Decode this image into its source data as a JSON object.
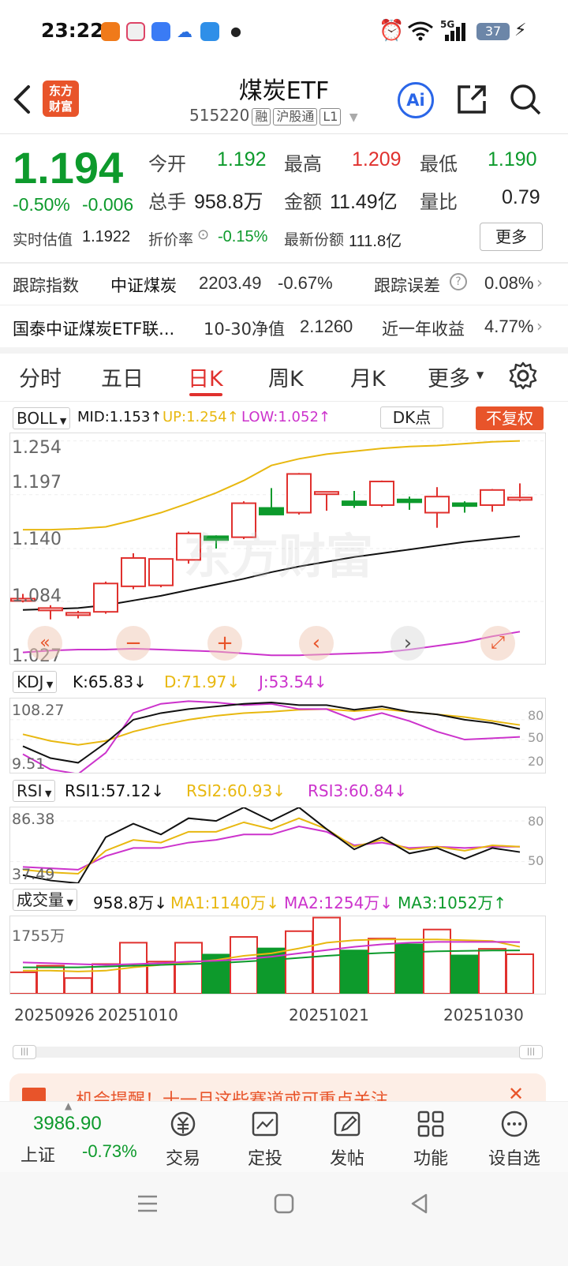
{
  "status": {
    "time": "23:22",
    "network": "5G",
    "battery": "37"
  },
  "header": {
    "title": "煤炭ETF",
    "code": "515220",
    "tags": [
      "融",
      "沪股通",
      "L1"
    ],
    "ai_label": "Ai",
    "logo_line1": "东方",
    "logo_line2": "财富"
  },
  "quote": {
    "price": "1.194",
    "change_pct": "-0.50%",
    "change": "-0.006",
    "open_label": "今开",
    "open": "1.192",
    "high_label": "最高",
    "high": "1.209",
    "low_label": "最低",
    "low": "1.190",
    "vol_label": "总手",
    "vol": "958.8万",
    "amount_label": "金额",
    "amount": "11.49亿",
    "ratio_label": "量比",
    "ratio": "0.79",
    "iopv_label": "实时估值",
    "iopv": "1.1922",
    "discount_label": "折价率",
    "discount": "-0.15%",
    "shares_label": "最新份额",
    "shares": "111.8亿",
    "more": "更多"
  },
  "tracking": {
    "label": "跟踪指数",
    "index": "中证煤炭",
    "value": "2203.49",
    "pct": "-0.67%",
    "err_label": "跟踪误差",
    "err": "0.08%"
  },
  "fund": {
    "name": "国泰中证煤炭ETF联...",
    "nav_label": "10-30净值",
    "nav": "2.1260",
    "ret_label": "近一年收益",
    "ret": "4.77%"
  },
  "tabs": [
    "分时",
    "五日",
    "日K",
    "周K",
    "月K",
    "更多"
  ],
  "boll": {
    "name": "BOLL",
    "mid": "MID:1.153↑",
    "up": "UP:1.254↑",
    "low": "LOW:1.052↑",
    "dk": "DK点",
    "fq": "不复权",
    "ticks": [
      "1.254",
      "1.197",
      "1.140",
      "1.084",
      "1.027"
    ],
    "watermark": "东方财富"
  },
  "kdj": {
    "name": "KDJ",
    "k": "K:65.83↓",
    "d": "D:71.97↓",
    "j": "J:53.54↓",
    "ticks": [
      "108.27",
      "9.51"
    ],
    "right": [
      "80",
      "50",
      "20"
    ]
  },
  "rsi": {
    "name": "RSI",
    "r1": "RSI1:57.12↓",
    "r2": "RSI2:60.93↓",
    "r3": "RSI3:60.84↓",
    "ticks": [
      "86.38",
      "37.49"
    ],
    "right": [
      "80",
      "50"
    ]
  },
  "volume": {
    "name": "成交量",
    "v": "958.8万↓",
    "ma1": "MA1:1140万↓",
    "ma2": "MA2:1254万↓",
    "ma3": "MA3:1052万↑",
    "tick": "1755万"
  },
  "dates": [
    "20250926",
    "20251010",
    "20251021",
    "20251030"
  ],
  "banner": {
    "text": "机会提醒！十一月这些赛道或可重点关注"
  },
  "bottom_nav": {
    "index_value": "3986.90",
    "index_name": "上证",
    "index_pct": "-0.73%",
    "items": [
      "交易",
      "定投",
      "发帖",
      "功能",
      "设自选"
    ]
  },
  "colors": {
    "up": "#e0312e",
    "down": "#0d9a2c",
    "mid": "#111111",
    "upper": "#e8b810",
    "lower": "#cc33cc"
  }
}
